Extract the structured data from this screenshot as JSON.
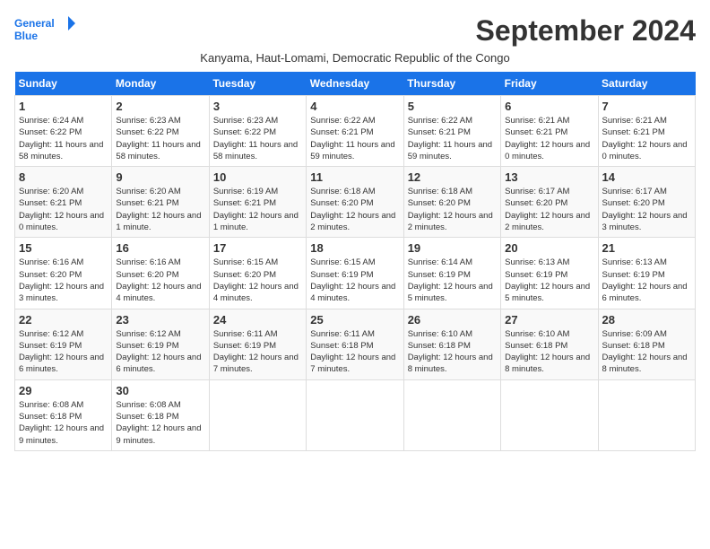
{
  "header": {
    "logo_line1": "General",
    "logo_line2": "Blue",
    "month": "September 2024",
    "subtitle": "Kanyama, Haut-Lomami, Democratic Republic of the Congo"
  },
  "days_of_week": [
    "Sunday",
    "Monday",
    "Tuesday",
    "Wednesday",
    "Thursday",
    "Friday",
    "Saturday"
  ],
  "weeks": [
    [
      {
        "day": "1",
        "info": "Sunrise: 6:24 AM\nSunset: 6:22 PM\nDaylight: 11 hours and 58 minutes."
      },
      {
        "day": "2",
        "info": "Sunrise: 6:23 AM\nSunset: 6:22 PM\nDaylight: 11 hours and 58 minutes."
      },
      {
        "day": "3",
        "info": "Sunrise: 6:23 AM\nSunset: 6:22 PM\nDaylight: 11 hours and 58 minutes."
      },
      {
        "day": "4",
        "info": "Sunrise: 6:22 AM\nSunset: 6:21 PM\nDaylight: 11 hours and 59 minutes."
      },
      {
        "day": "5",
        "info": "Sunrise: 6:22 AM\nSunset: 6:21 PM\nDaylight: 11 hours and 59 minutes."
      },
      {
        "day": "6",
        "info": "Sunrise: 6:21 AM\nSunset: 6:21 PM\nDaylight: 12 hours and 0 minutes."
      },
      {
        "day": "7",
        "info": "Sunrise: 6:21 AM\nSunset: 6:21 PM\nDaylight: 12 hours and 0 minutes."
      }
    ],
    [
      {
        "day": "8",
        "info": "Sunrise: 6:20 AM\nSunset: 6:21 PM\nDaylight: 12 hours and 0 minutes."
      },
      {
        "day": "9",
        "info": "Sunrise: 6:20 AM\nSunset: 6:21 PM\nDaylight: 12 hours and 1 minute."
      },
      {
        "day": "10",
        "info": "Sunrise: 6:19 AM\nSunset: 6:21 PM\nDaylight: 12 hours and 1 minute."
      },
      {
        "day": "11",
        "info": "Sunrise: 6:18 AM\nSunset: 6:20 PM\nDaylight: 12 hours and 2 minutes."
      },
      {
        "day": "12",
        "info": "Sunrise: 6:18 AM\nSunset: 6:20 PM\nDaylight: 12 hours and 2 minutes."
      },
      {
        "day": "13",
        "info": "Sunrise: 6:17 AM\nSunset: 6:20 PM\nDaylight: 12 hours and 2 minutes."
      },
      {
        "day": "14",
        "info": "Sunrise: 6:17 AM\nSunset: 6:20 PM\nDaylight: 12 hours and 3 minutes."
      }
    ],
    [
      {
        "day": "15",
        "info": "Sunrise: 6:16 AM\nSunset: 6:20 PM\nDaylight: 12 hours and 3 minutes."
      },
      {
        "day": "16",
        "info": "Sunrise: 6:16 AM\nSunset: 6:20 PM\nDaylight: 12 hours and 4 minutes."
      },
      {
        "day": "17",
        "info": "Sunrise: 6:15 AM\nSunset: 6:20 PM\nDaylight: 12 hours and 4 minutes."
      },
      {
        "day": "18",
        "info": "Sunrise: 6:15 AM\nSunset: 6:19 PM\nDaylight: 12 hours and 4 minutes."
      },
      {
        "day": "19",
        "info": "Sunrise: 6:14 AM\nSunset: 6:19 PM\nDaylight: 12 hours and 5 minutes."
      },
      {
        "day": "20",
        "info": "Sunrise: 6:13 AM\nSunset: 6:19 PM\nDaylight: 12 hours and 5 minutes."
      },
      {
        "day": "21",
        "info": "Sunrise: 6:13 AM\nSunset: 6:19 PM\nDaylight: 12 hours and 6 minutes."
      }
    ],
    [
      {
        "day": "22",
        "info": "Sunrise: 6:12 AM\nSunset: 6:19 PM\nDaylight: 12 hours and 6 minutes."
      },
      {
        "day": "23",
        "info": "Sunrise: 6:12 AM\nSunset: 6:19 PM\nDaylight: 12 hours and 6 minutes."
      },
      {
        "day": "24",
        "info": "Sunrise: 6:11 AM\nSunset: 6:19 PM\nDaylight: 12 hours and 7 minutes."
      },
      {
        "day": "25",
        "info": "Sunrise: 6:11 AM\nSunset: 6:18 PM\nDaylight: 12 hours and 7 minutes."
      },
      {
        "day": "26",
        "info": "Sunrise: 6:10 AM\nSunset: 6:18 PM\nDaylight: 12 hours and 8 minutes."
      },
      {
        "day": "27",
        "info": "Sunrise: 6:10 AM\nSunset: 6:18 PM\nDaylight: 12 hours and 8 minutes."
      },
      {
        "day": "28",
        "info": "Sunrise: 6:09 AM\nSunset: 6:18 PM\nDaylight: 12 hours and 8 minutes."
      }
    ],
    [
      {
        "day": "29",
        "info": "Sunrise: 6:08 AM\nSunset: 6:18 PM\nDaylight: 12 hours and 9 minutes."
      },
      {
        "day": "30",
        "info": "Sunrise: 6:08 AM\nSunset: 6:18 PM\nDaylight: 12 hours and 9 minutes."
      },
      {
        "day": "",
        "info": ""
      },
      {
        "day": "",
        "info": ""
      },
      {
        "day": "",
        "info": ""
      },
      {
        "day": "",
        "info": ""
      },
      {
        "day": "",
        "info": ""
      }
    ]
  ]
}
